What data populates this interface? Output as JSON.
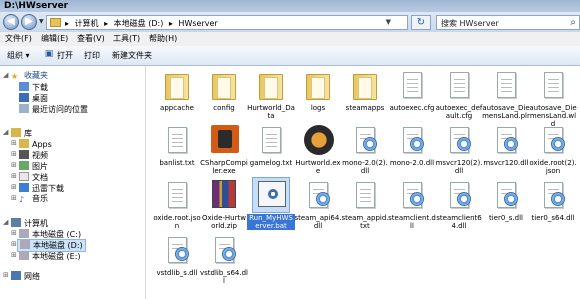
{
  "title": "D:\\HWserver",
  "nav": {
    "crumbs": [
      "▸",
      "计算机",
      "▸",
      "本地磁盘 (D:)",
      "▸",
      "HWserver"
    ],
    "search_placeholder": "搜索 HWserver"
  },
  "menu": [
    "文件(F)",
    "编辑(E)",
    "查看(V)",
    "工具(T)",
    "帮助(H)"
  ],
  "toolbar": {
    "organize": "组织 ▾",
    "open": "打开",
    "print": "打印",
    "new_folder": "新建文件夹"
  },
  "sidebar": {
    "favorites": "收藏夹",
    "downloads": "下载",
    "desktop": "桌面",
    "recent": "最近访问的位置",
    "library": "库",
    "apps": "Apps",
    "videos": "视频",
    "pictures": "图片",
    "docs": "文档",
    "xunlei": "迅雷下载",
    "music": "音乐",
    "computer": "计算机",
    "disk_c": "本地磁盘 (C:)",
    "disk_d": "本地磁盘 (D:)",
    "disk_e": "本地磁盘 (E:)",
    "network": "网络"
  },
  "files": [
    {
      "name": "appcache",
      "type": "folder"
    },
    {
      "name": "config",
      "type": "folder"
    },
    {
      "name": "Hurtworld_Data",
      "type": "folder"
    },
    {
      "name": "logs",
      "type": "folder"
    },
    {
      "name": "steamapps",
      "type": "folder"
    },
    {
      "name": "autoexec.cfg",
      "type": "doc"
    },
    {
      "name": "autoexec_default.cfg",
      "type": "doc"
    },
    {
      "name": "autosave_DiemensLand.plr",
      "type": "doc"
    },
    {
      "name": "autosave_DiemensLand.wld",
      "type": "doc"
    },
    {
      "name": "banlist.txt",
      "type": "doc"
    },
    {
      "name": "CSharpCompiler.exe",
      "type": "rust"
    },
    {
      "name": "gamelog.txt",
      "type": "doc"
    },
    {
      "name": "Hurtworld.exe",
      "type": "skull"
    },
    {
      "name": "mono-2.0(2).dll",
      "type": "dll"
    },
    {
      "name": "mono-2.0.dll",
      "type": "dll"
    },
    {
      "name": "msvcr120(2).dll",
      "type": "dll"
    },
    {
      "name": "msvcr120.dll",
      "type": "dll"
    },
    {
      "name": "oxide.root(2).json",
      "type": "dll"
    },
    {
      "name": "oxide.root.json",
      "type": "doc"
    },
    {
      "name": "Oxide-Hurtworld.zip",
      "type": "zip"
    },
    {
      "name": "Run_MyHWServer.bat",
      "type": "bat",
      "selected": true
    },
    {
      "name": "steam_api64.dll",
      "type": "dll"
    },
    {
      "name": "steam_appid.txt",
      "type": "doc"
    },
    {
      "name": "steamclient.dll",
      "type": "dll"
    },
    {
      "name": "steamclient64.dll",
      "type": "dll"
    },
    {
      "name": "tier0_s.dll",
      "type": "dll"
    },
    {
      "name": "tier0_s64.dll",
      "type": "dll"
    },
    {
      "name": "vstdlib_s.dll",
      "type": "dll"
    },
    {
      "name": "vstdlib_s64.dll",
      "type": "dll"
    }
  ]
}
